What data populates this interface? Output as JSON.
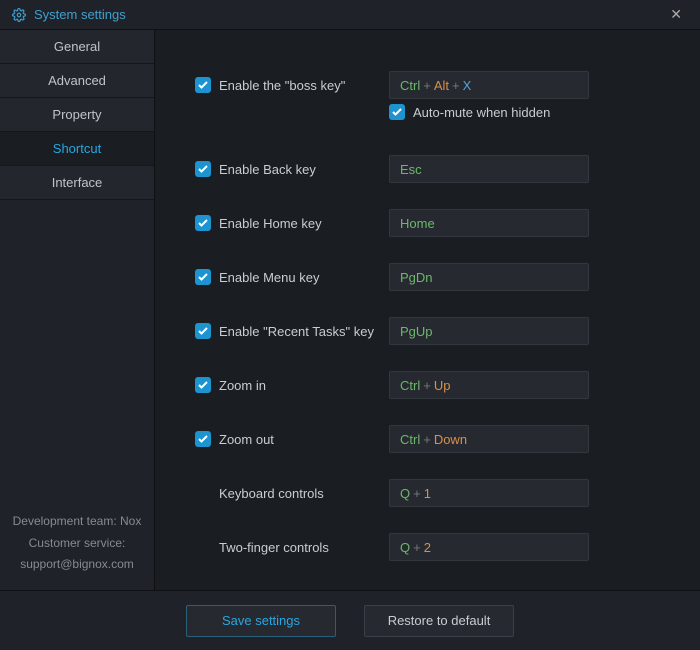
{
  "window": {
    "title": "System settings"
  },
  "sidebar": {
    "tabs": [
      {
        "label": "General"
      },
      {
        "label": "Advanced"
      },
      {
        "label": "Property"
      },
      {
        "label": "Shortcut"
      },
      {
        "label": "Interface"
      }
    ],
    "footer": {
      "line1": "Development team: Nox",
      "line2": "Customer service:",
      "line3": "support@bignox.com"
    }
  },
  "settings": {
    "bosskey": {
      "label": "Enable the \"boss key\"",
      "value": "Ctrl + Alt + X"
    },
    "automute": {
      "label": "Auto-mute when hidden"
    },
    "back": {
      "label": "Enable Back key",
      "value": "Esc"
    },
    "home": {
      "label": "Enable Home key",
      "value": "Home"
    },
    "menu": {
      "label": "Enable Menu key",
      "value": "PgDn"
    },
    "recent": {
      "label": "Enable \"Recent Tasks\" key",
      "value": "PgUp"
    },
    "zoomin": {
      "label": "Zoom in",
      "value": "Ctrl + Up"
    },
    "zoomout": {
      "label": "Zoom out",
      "value": "Ctrl + Down"
    },
    "keyboard": {
      "label": "Keyboard controls",
      "value": "Q + 1"
    },
    "twofinger": {
      "label": "Two-finger controls",
      "value": "Q + 2"
    }
  },
  "buttons": {
    "save": "Save settings",
    "restore": "Restore to default"
  }
}
